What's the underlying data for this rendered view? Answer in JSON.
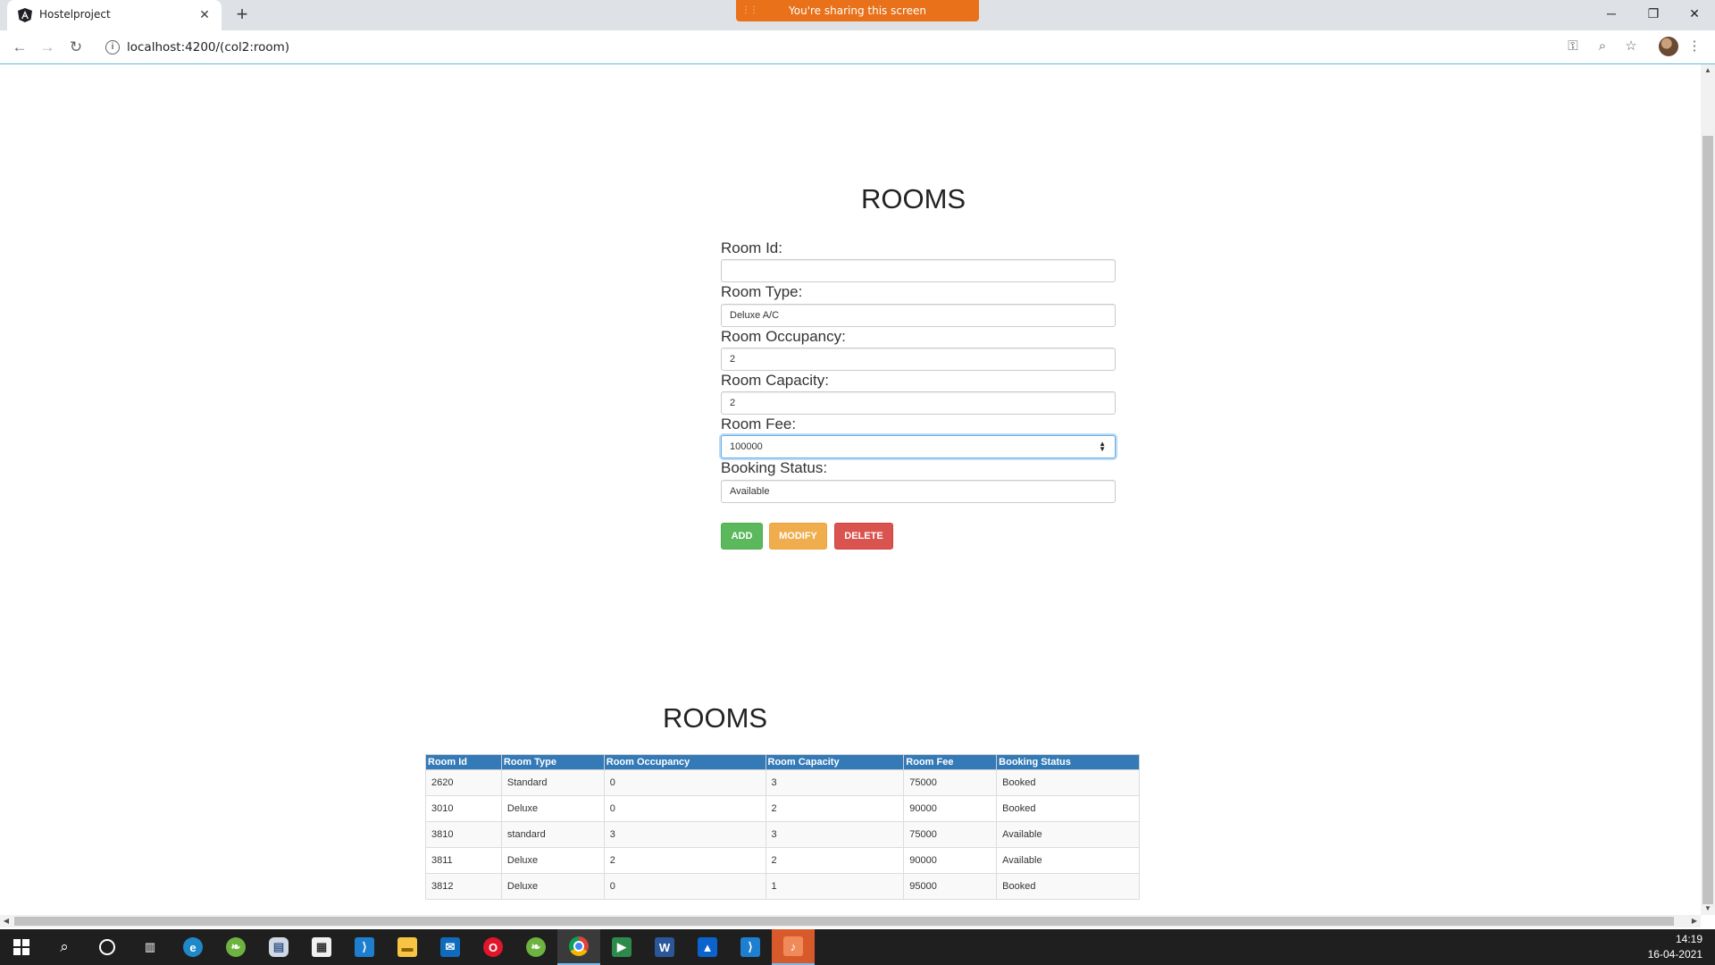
{
  "browser": {
    "tab_title": "Hostelproject",
    "tab_close": "✕",
    "new_tab": "+",
    "share_banner": "You're sharing this screen",
    "url": "localhost:4200/(col2:room)",
    "window_controls": {
      "minimize": "─",
      "restore": "❐",
      "close": "✕"
    }
  },
  "form": {
    "title": "ROOMS",
    "fields": [
      {
        "label": "Room Id:",
        "value": ""
      },
      {
        "label": "Room Type:",
        "value": "Deluxe A/C"
      },
      {
        "label": "Room Occupancy:",
        "value": "2"
      },
      {
        "label": "Room Capacity:",
        "value": "2"
      },
      {
        "label": "Room Fee:",
        "value": "100000"
      },
      {
        "label": "Booking Status:",
        "value": "Available"
      }
    ],
    "buttons": {
      "add": "ADD",
      "modify": "MODIFY",
      "delete": "DELETE"
    }
  },
  "table": {
    "title": "ROOMS",
    "headers": [
      "Room Id",
      "Room Type",
      "Room Occupancy",
      "Room Capacity",
      "Room Fee",
      "Booking Status"
    ],
    "rows": [
      [
        "2620",
        "Standard",
        "0",
        "3",
        "75000",
        "Booked"
      ],
      [
        "3010",
        "Deluxe",
        "0",
        "2",
        "90000",
        "Booked"
      ],
      [
        "3810",
        "standard",
        "3",
        "3",
        "75000",
        "Available"
      ],
      [
        "3811",
        "Deluxe",
        "2",
        "2",
        "90000",
        "Available"
      ],
      [
        "3812",
        "Deluxe",
        "0",
        "1",
        "95000",
        "Booked"
      ]
    ]
  },
  "taskbar": {
    "time": "14:19",
    "date": "16-04-2021",
    "accent": "#76b9ed"
  }
}
